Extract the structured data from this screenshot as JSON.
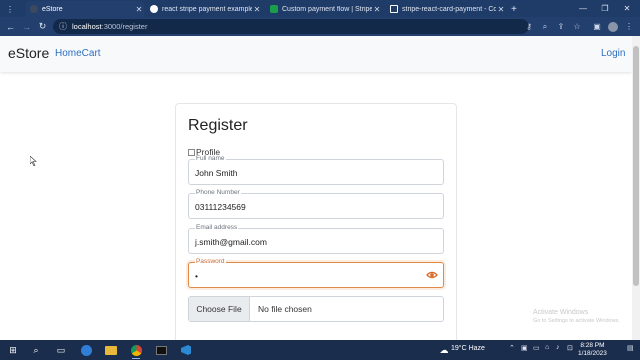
{
  "browser": {
    "tabs": [
      {
        "title": "eStore",
        "active": true,
        "favicon_color": "#3b4a5e"
      },
      {
        "title": "react stripe payment example - (",
        "active": false,
        "favicon_color": "#ffffff"
      },
      {
        "title": "Custom payment flow | Stripe Do",
        "active": false,
        "favicon_color": "#1a9e4b"
      },
      {
        "title": "stripe-react-card-payment - Cod",
        "active": false,
        "favicon_color": "#ffffff"
      }
    ],
    "new_tab": "+",
    "url_host": "localhost",
    "url_path": ":3000/register"
  },
  "navbar": {
    "brand": "eStore",
    "home_cart": "HomeCart",
    "login": "Login"
  },
  "form": {
    "title": "Register",
    "profile_alt": "Profile",
    "full_name": {
      "label": "Full name",
      "value": "John Smith"
    },
    "phone": {
      "label": "Phone Number",
      "value": "03111234569"
    },
    "email": {
      "label": "Email address",
      "value": "j.smith@gmail.com"
    },
    "password": {
      "label": "Password",
      "value": "•"
    },
    "file_button": "Choose File",
    "file_status": "No file chosen"
  },
  "watermark": {
    "line1": "Activate Windows",
    "line2": "Go to Settings to activate Windows."
  },
  "taskbar": {
    "weather": "19°C  Haze",
    "time": "8:28 PM",
    "date": "1/18/2023"
  },
  "colors": {
    "accent_focus": "#e08a4a",
    "link": "#2e6fbf",
    "browser_frame": "#1f3b67"
  }
}
